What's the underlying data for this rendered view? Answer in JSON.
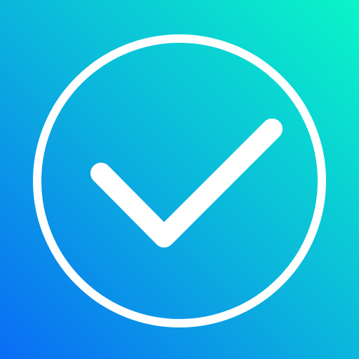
{
  "icon": {
    "name": "checkmark-circle-icon",
    "colors": {
      "gradient_start": "#0a6cf5",
      "gradient_mid": "#0bb6dc",
      "gradient_end": "#0af5c8",
      "glyph": "#ffffff"
    }
  }
}
